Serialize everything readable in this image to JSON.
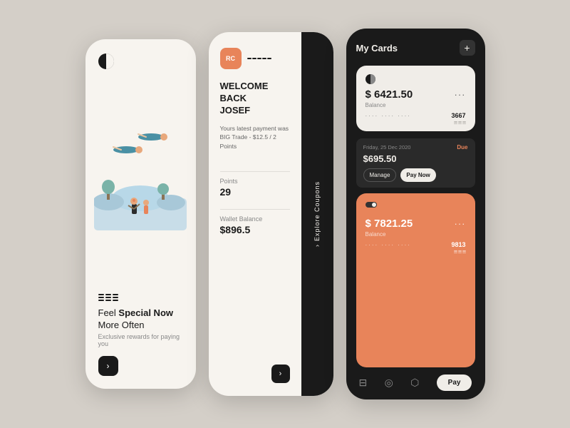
{
  "phone1": {
    "feel_text": "Feel",
    "special_text": "Special Now",
    "more_often": "More Often",
    "exclusive_text": "Exclusive rewards for paying you",
    "arrow": "›"
  },
  "phone2": {
    "rc_label": "RC",
    "welcome": "WELCOME BACK",
    "name": "JOSEF",
    "payment_text": "Yours latest payment was",
    "payment_detail": "BIG Trade - $12.5 / 2 Points",
    "points_label": "Points",
    "points_value": "29",
    "wallet_label": "Wallet Balance",
    "wallet_value": "$896.5",
    "explore_label": "Explore Coupons",
    "explore_chevron": "›",
    "arrow": "›"
  },
  "phone3": {
    "title": "My Cards",
    "plus": "+",
    "card1": {
      "amount": "$ 6421.50",
      "dots": "···",
      "balance_label": "Balance",
      "card_dots": "····  ····  ····",
      "last4": "3667"
    },
    "due": {
      "date": "Friday, 25 Dec 2020",
      "due_label": "Due",
      "amount": "$695.50",
      "manage": "Manage",
      "pay_now": "Pay Now"
    },
    "card2": {
      "amount": "$ 7821.25",
      "dots": "···",
      "balance_label": "Balance",
      "card_dots": "····  ····  ····",
      "last4": "9813"
    },
    "nav": {
      "pay": "Pay"
    }
  }
}
